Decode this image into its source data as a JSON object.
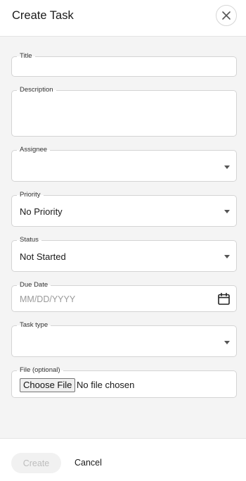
{
  "header": {
    "title": "Create Task",
    "close_icon": "close-icon"
  },
  "form": {
    "title": {
      "label": "Title",
      "value": ""
    },
    "description": {
      "label": "Description",
      "value": ""
    },
    "assignee": {
      "label": "Assignee",
      "value": ""
    },
    "priority": {
      "label": "Priority",
      "value": "No Priority"
    },
    "status": {
      "label": "Status",
      "value": "Not Started"
    },
    "due_date": {
      "label": "Due Date",
      "placeholder": "MM/DD/YYYY",
      "icon": "calendar-icon"
    },
    "task_type": {
      "label": "Task type",
      "value": ""
    },
    "file": {
      "label": "File (optional)",
      "button_label": "Choose File",
      "status": "No file chosen"
    }
  },
  "footer": {
    "create_label": "Create",
    "cancel_label": "Cancel"
  }
}
